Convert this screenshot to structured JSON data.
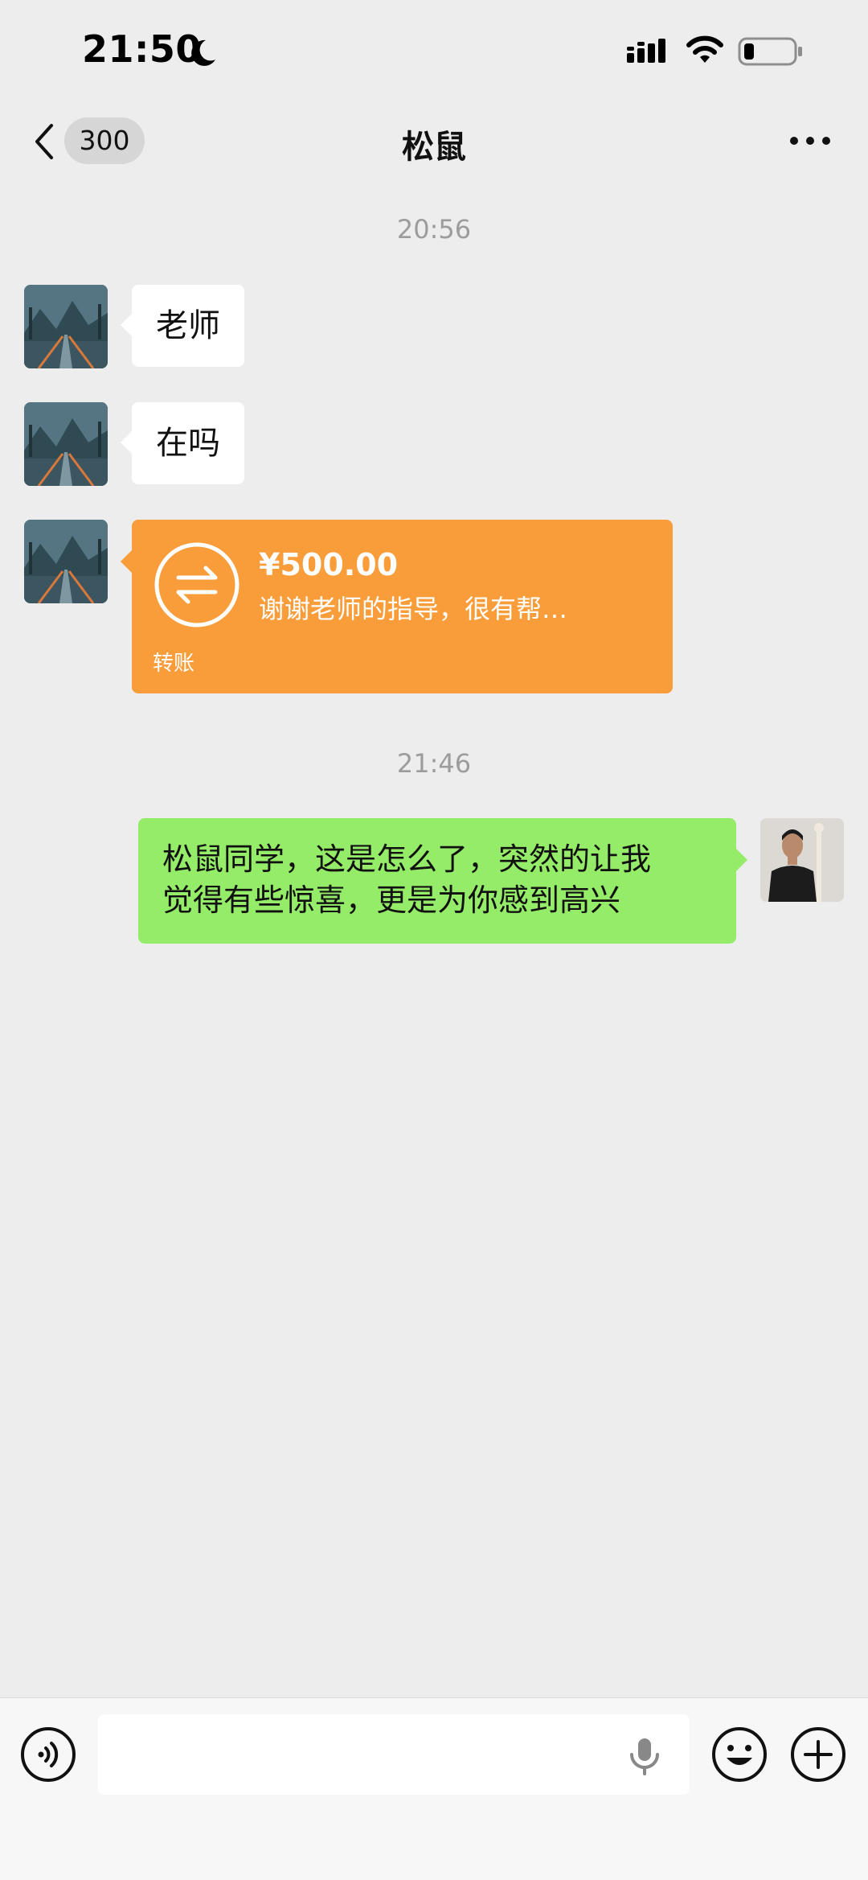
{
  "status_bar": {
    "time": "21:50"
  },
  "nav": {
    "unread_count": "300",
    "title": "松鼠"
  },
  "messages": {
    "timestamp_1": "20:56",
    "msg_1": "老师",
    "msg_2": "在吗",
    "transfer": {
      "amount": "¥500.00",
      "note": "谢谢老师的指导，很有帮…",
      "label": "转账"
    },
    "timestamp_2": "21:46",
    "reply_line_1": "松鼠同学，这是怎么了，突然的让我",
    "reply_line_2": "觉得有些惊喜，更是为你感到高兴"
  },
  "colors": {
    "transfer": "#f99d3b",
    "sent_bubble": "#95ec69",
    "background": "#ededed"
  },
  "icons": [
    "moon-icon",
    "signal-icon",
    "wifi-icon",
    "battery-icon",
    "back-icon",
    "more-icon",
    "transfer-icon",
    "voice-icon",
    "mic-icon",
    "emoji-icon",
    "plus-icon"
  ]
}
